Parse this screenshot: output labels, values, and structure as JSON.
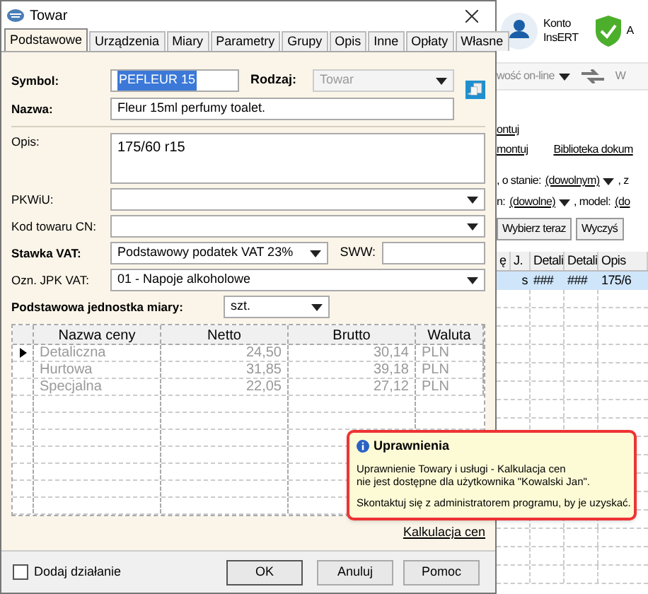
{
  "window": {
    "title": "Towar"
  },
  "tabs": [
    {
      "label": "Podstawowe",
      "selected": true
    },
    {
      "label": "Urządzenia",
      "selected": false
    },
    {
      "label": "Miary",
      "selected": false
    },
    {
      "label": "Parametry",
      "selected": false
    },
    {
      "label": "Grupy",
      "selected": false
    },
    {
      "label": "Opis",
      "selected": false
    },
    {
      "label": "Inne",
      "selected": false
    },
    {
      "label": "Opłaty",
      "selected": false
    },
    {
      "label": "Własne",
      "selected": false
    }
  ],
  "symbol": {
    "label": "Symbol:",
    "value": "PEFLEUR 15"
  },
  "rodzaj": {
    "label": "Rodzaj:",
    "value": "Towar",
    "disabled": true
  },
  "nazwa": {
    "label": "Nazwa:",
    "value": "Fleur 15ml perfumy toalet."
  },
  "opis": {
    "label": "Opis:",
    "value": "175/60 r15"
  },
  "pkwiu": {
    "label": "PKWiU:"
  },
  "cn": {
    "label": "Kod towaru CN:"
  },
  "vat": {
    "label": "Stawka VAT:",
    "value": "Podstawowy podatek VAT 23%"
  },
  "sww": {
    "label": "SWW:"
  },
  "jpk": {
    "label": "Ozn. JPK VAT:",
    "value": "01 - Napoje alkoholowe"
  },
  "unit": {
    "label": "Podstawowa jednostka miary:",
    "value": "szt."
  },
  "table": {
    "columns": [
      "Nazwa ceny",
      "Netto",
      "Brutto",
      "Waluta"
    ],
    "rows": [
      {
        "cells": [
          "Detaliczna",
          "24,50",
          "30,14",
          "PLN"
        ],
        "selected": true
      },
      {
        "cells": [
          "Hurtowa",
          "31,85",
          "39,18",
          "PLN"
        ],
        "selected": false
      },
      {
        "cells": [
          "Specjalna",
          "22,05",
          "27,12",
          "PLN"
        ],
        "selected": false
      }
    ]
  },
  "tooltip": {
    "title": "Uprawnienia",
    "lines": [
      "Uprawnienie Towary i usługi - Kalkulacja cen",
      "nie jest dostępne dla użytkownika \"Kowalski Jan\"."
    ],
    "note": "Skontaktuj się z administratorem programu, by je uzyskać."
  },
  "link": "Kalkulacja cen",
  "add_action": {
    "label": "Dodaj działanie",
    "checked": false
  },
  "buttons": [
    "OK",
    "Anuluj",
    "Pomoc"
  ],
  "background": {
    "account": "Konto",
    "account2": "InsERT",
    "shield_label": "A",
    "toolbar": "wość on-line",
    "toolbar2": "W",
    "links": [
      "ontuj",
      "montuj",
      "Biblioteka dokum"
    ],
    "filter1": [
      ", o stanie:",
      "(dowolnym)",
      ", z"
    ],
    "filter2": [
      "n:",
      "(dowolne)",
      ", model:",
      "(do"
    ],
    "buttons": [
      "Wybierz teraz",
      "Wyczyś"
    ],
    "columns": [
      "ę",
      "J.",
      "Detali",
      "Detali",
      "Opis"
    ],
    "row": [
      "s",
      "###",
      "###",
      "175/6"
    ]
  }
}
